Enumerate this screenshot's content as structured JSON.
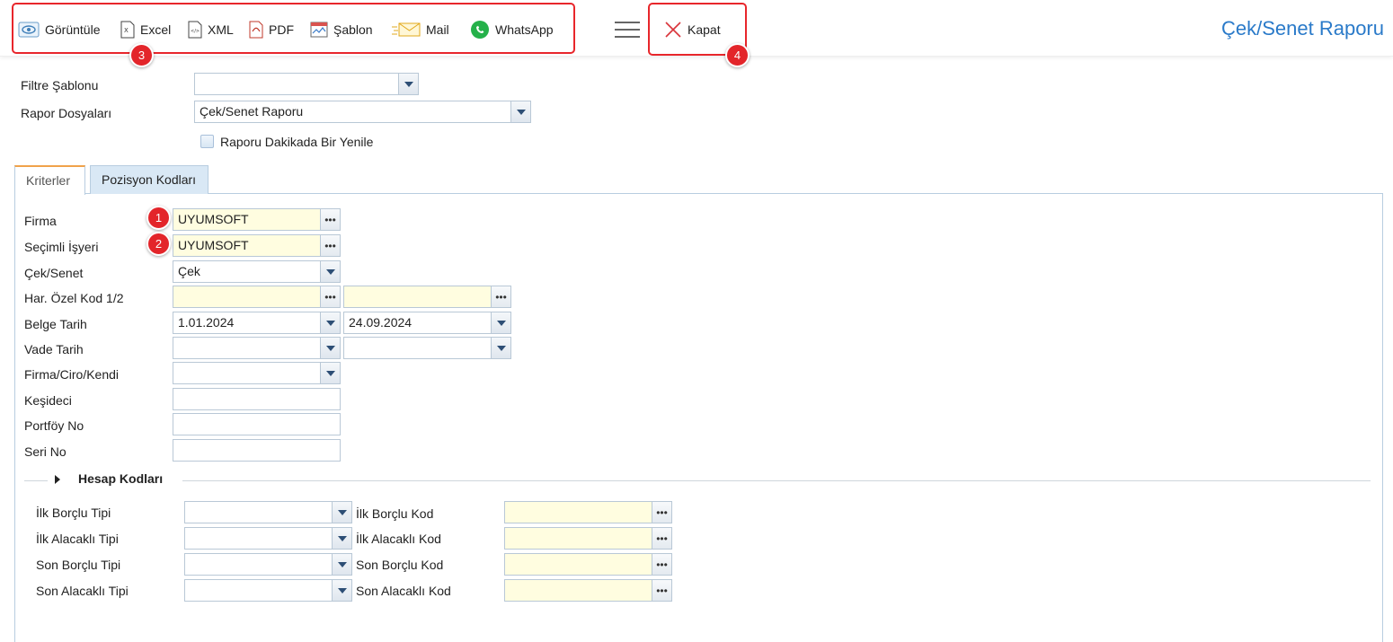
{
  "header": {
    "title": "Çek/Senet Raporu",
    "toolbar": [
      {
        "label": "Görüntüle",
        "icon": "view-icon"
      },
      {
        "label": "Excel",
        "icon": "excel-file-icon"
      },
      {
        "label": "XML",
        "icon": "xml-file-icon"
      },
      {
        "label": "PDF",
        "icon": "pdf-file-icon"
      },
      {
        "label": "Şablon",
        "icon": "template-icon"
      },
      {
        "label": "Mail",
        "icon": "mail-icon"
      },
      {
        "label": "WhatsApp",
        "icon": "whatsapp-icon"
      }
    ],
    "close_label": "Kapat",
    "badges": [
      "1",
      "2",
      "3",
      "4"
    ]
  },
  "top_form": {
    "filter_template_label": "Filtre Şablonu",
    "filter_template_value": "",
    "report_files_label": "Rapor Dosyaları",
    "report_files_value": "Çek/Senet Raporu",
    "refresh_label": "Raporu Dakikada Bir Yenile"
  },
  "tabs": [
    {
      "label": "Kriterler",
      "active": true
    },
    {
      "label": "Pozisyon Kodları",
      "active": false
    }
  ],
  "criteria": {
    "firma": {
      "label": "Firma",
      "value": "UYUMSOFT"
    },
    "isyeri": {
      "label": "Seçimli İşyeri",
      "value": "UYUMSOFT"
    },
    "ceksenet": {
      "label": "Çek/Senet",
      "value": "Çek"
    },
    "ozelkod": {
      "label": "Har. Özel Kod 1/2",
      "value1": "",
      "value2": ""
    },
    "belgetarih": {
      "label": "Belge Tarih",
      "value1": "1.01.2024",
      "value2": "24.09.2024"
    },
    "vadetarih": {
      "label": "Vade Tarih",
      "value1": "",
      "value2": ""
    },
    "firmacirokendi": {
      "label": "Firma/Ciro/Kendi",
      "value": ""
    },
    "kesideci": {
      "label": "Keşideci",
      "value": ""
    },
    "portfoy": {
      "label": "Portföy No",
      "value": ""
    },
    "seri": {
      "label": "Seri No",
      "value": ""
    }
  },
  "hesap": {
    "section_title": "Hesap Kodları",
    "rows": [
      {
        "type_label": "İlk Borçlu Tipi",
        "code_label": "İlk Borçlu Kod"
      },
      {
        "type_label": "İlk Alacaklı Tipi",
        "code_label": "İlk Alacaklı Kod"
      },
      {
        "type_label": "Son Borçlu Tipi",
        "code_label": "Son Borçlu Kod"
      },
      {
        "type_label": "Son Alacaklı Tipi",
        "code_label": "Son Alacaklı Kod"
      }
    ]
  },
  "colors": {
    "accent_title": "#2a7ac9",
    "highlight_red": "#e3252a",
    "field_yellow": "#fffde0",
    "tab_active_border": "#f0a24a"
  }
}
